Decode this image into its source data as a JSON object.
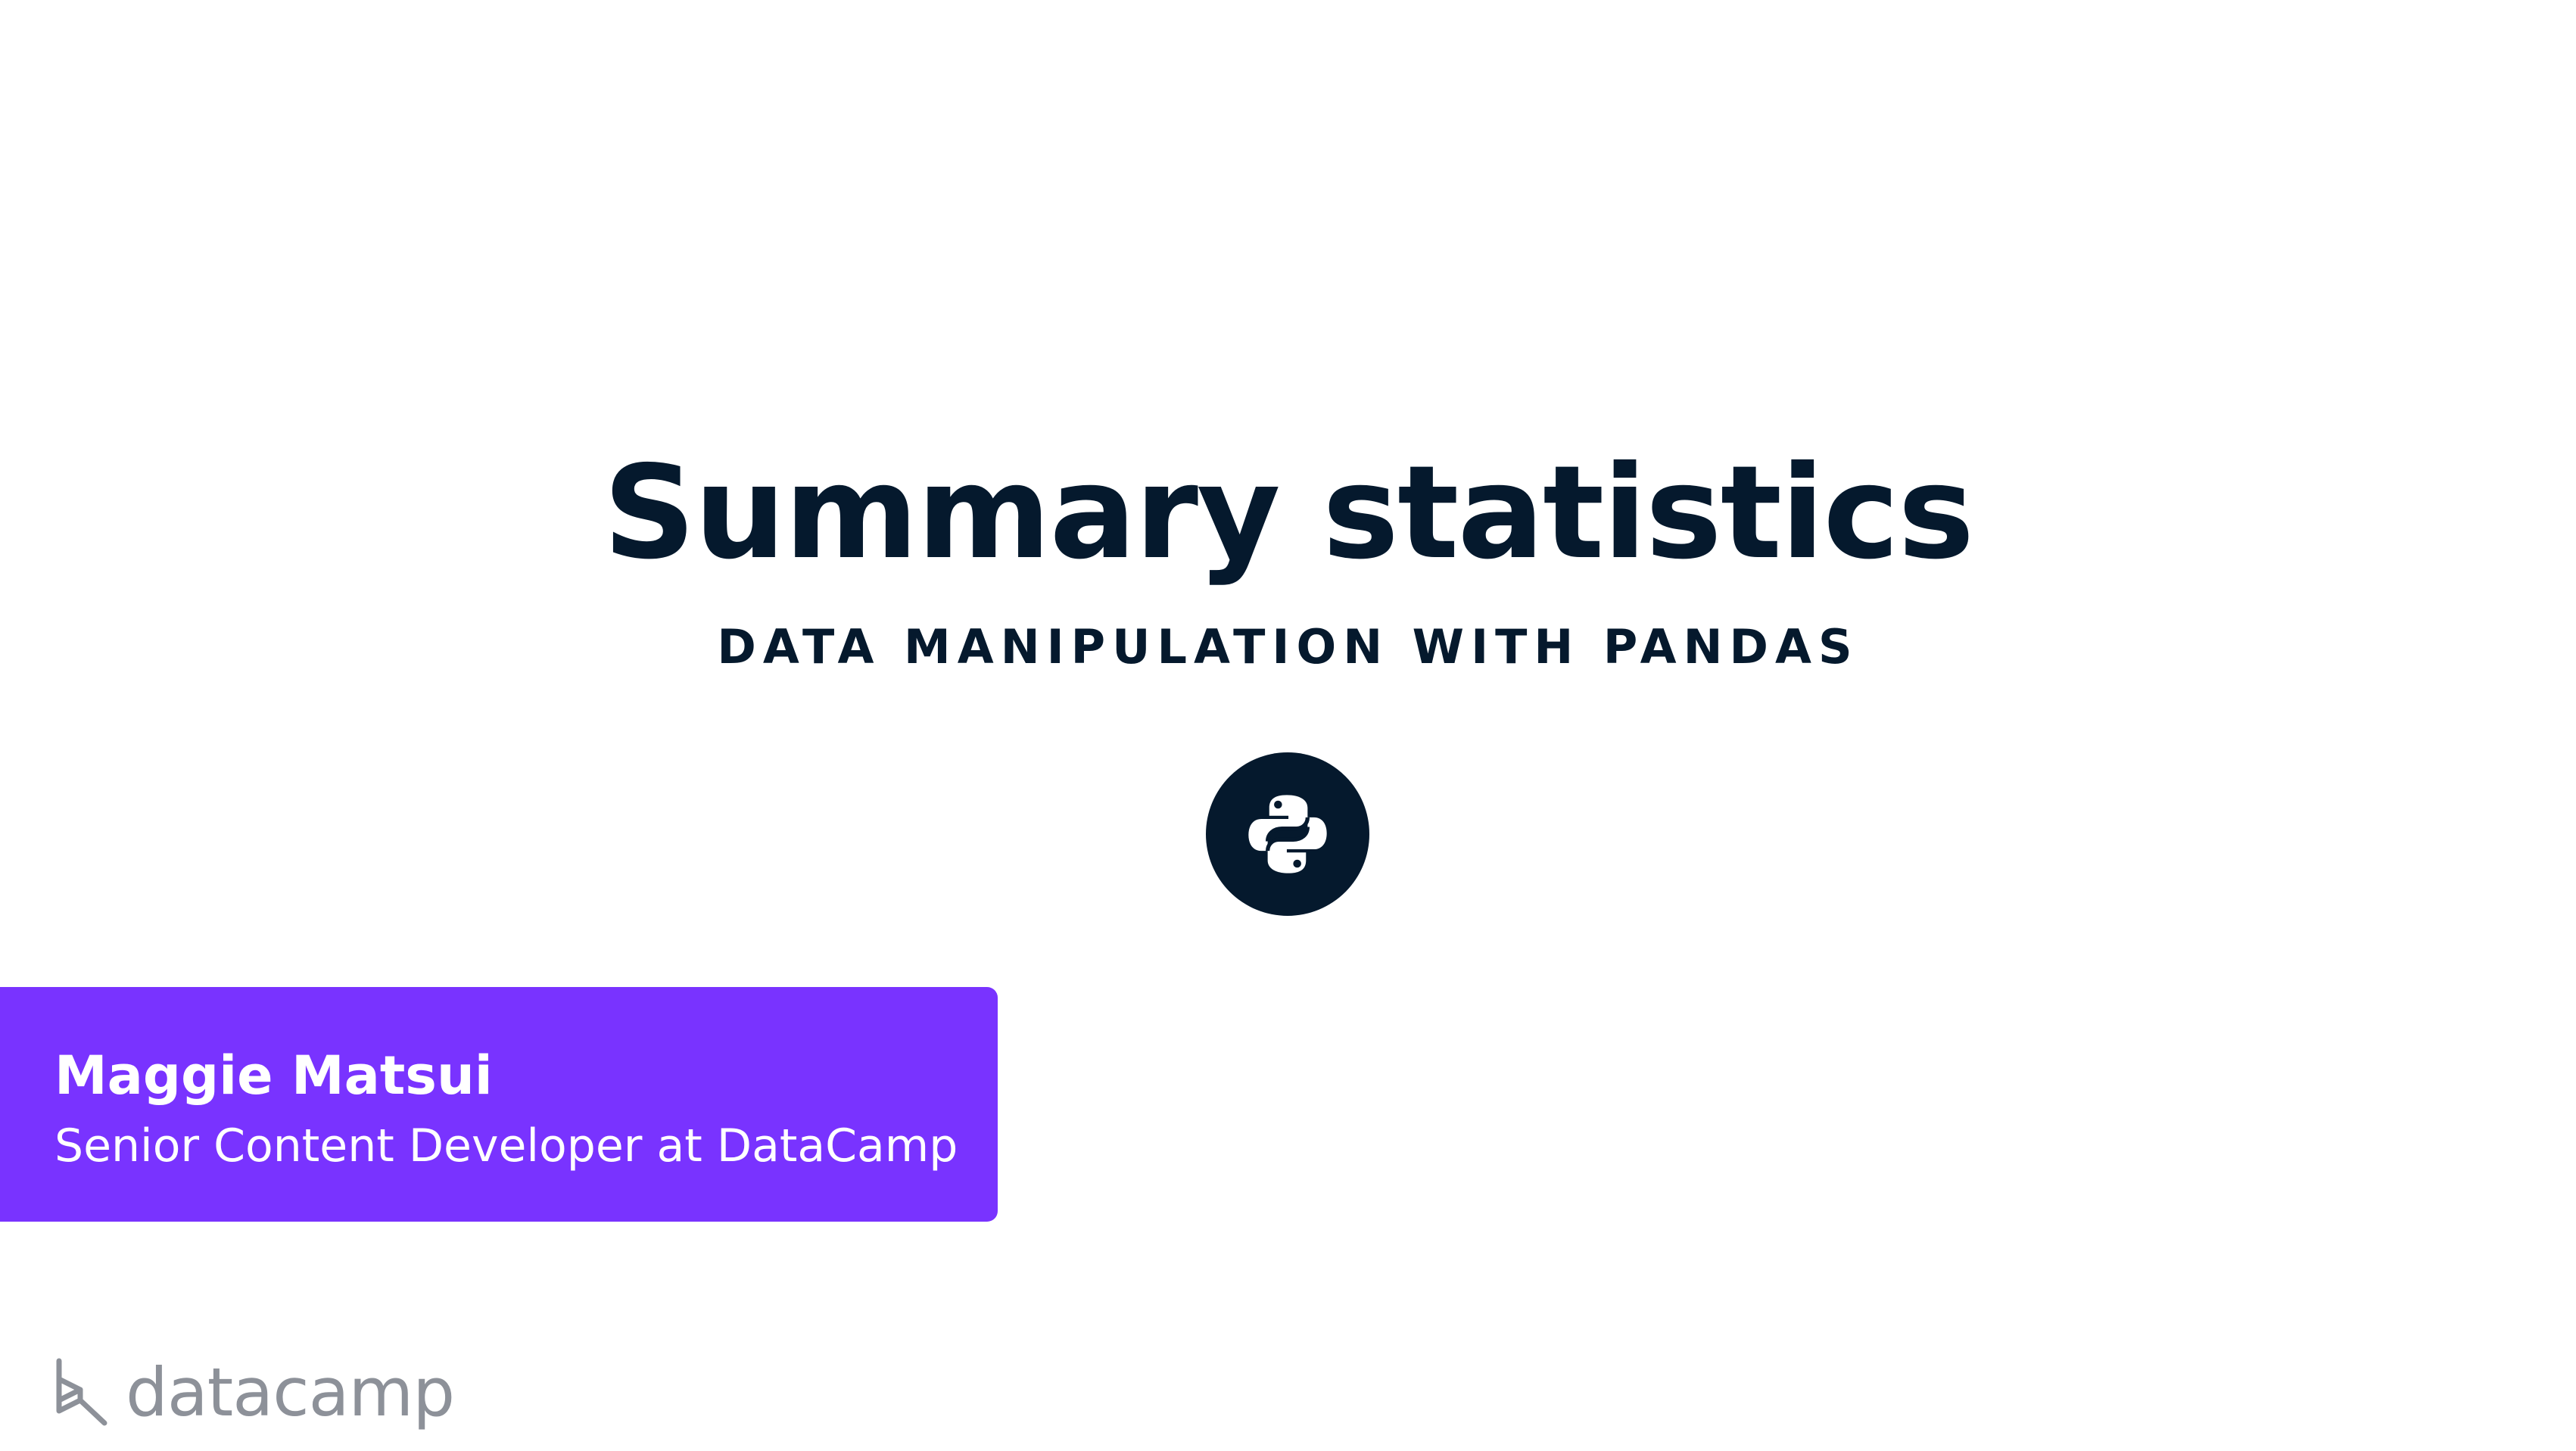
{
  "slide": {
    "title": "Summary statistics",
    "subtitle": "DATA MANIPULATION WITH PANDAS",
    "course_icon": "python-logo-icon"
  },
  "author": {
    "name": "Maggie Matsui",
    "role": "Senior Content Developer at DataCamp"
  },
  "brand": {
    "logo_icon": "datacamp-logo-icon",
    "name": "datacamp"
  },
  "colors": {
    "title": "#05192d",
    "accent": "#7933ff",
    "brand_gray": "#8d9199",
    "background": "#ffffff"
  }
}
